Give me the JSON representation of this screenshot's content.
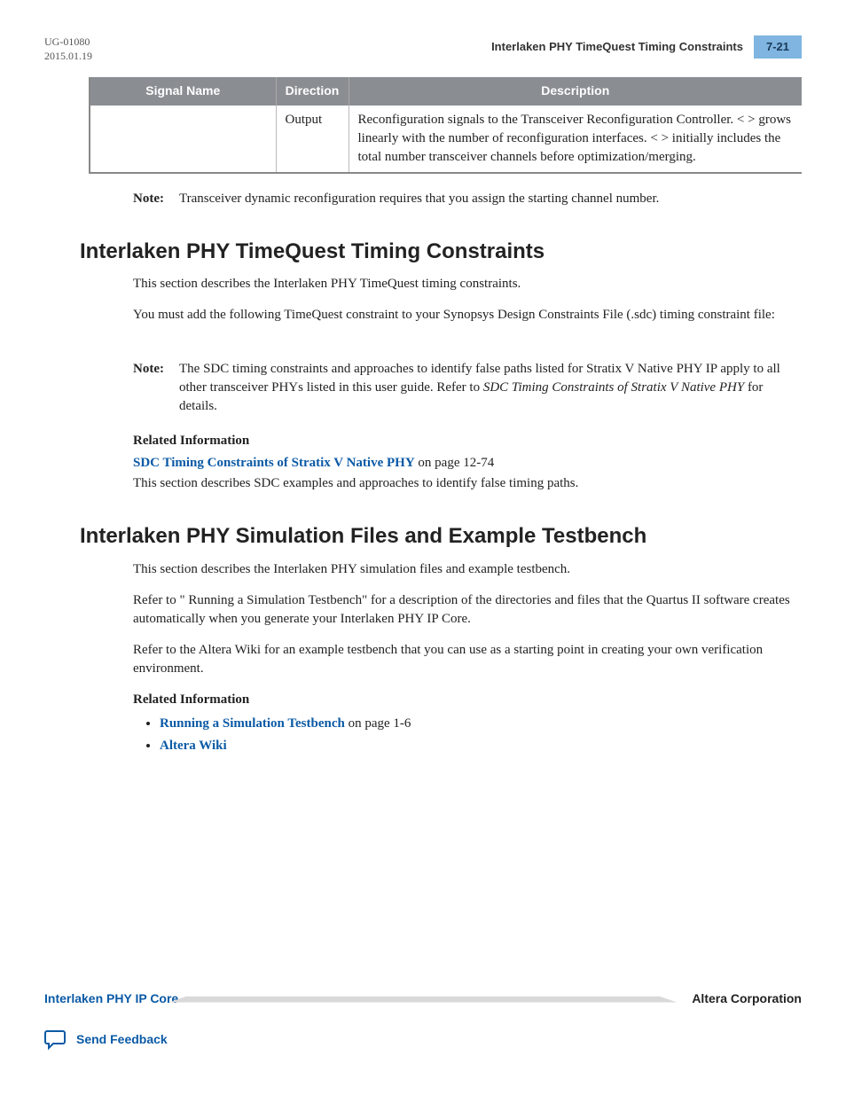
{
  "header": {
    "doc_id": "UG-01080",
    "date": "2015.01.19",
    "running_title": "Interlaken PHY TimeQuest Timing Constraints",
    "page_num": "7-21"
  },
  "table": {
    "headers": [
      "Signal Name",
      "Direction",
      "Description"
    ],
    "row": {
      "signal_name": "",
      "direction": "Output",
      "description": "Reconfiguration signals to the Transceiver Reconfiguration Controller. <  > grows linearly with the number of reconfiguration interfaces. <  > initially includes the total number transceiver channels before optimization/merging."
    }
  },
  "note_top": {
    "label": "Note:",
    "text": "Transceiver dynamic reconfiguration requires that you assign the starting channel number."
  },
  "section1": {
    "heading": "Interlaken PHY TimeQuest Timing Constraints",
    "p1": "This section describes the Interlaken PHY TimeQuest timing constraints.",
    "p2": "You must add the following TimeQuest constraint to your Synopsys Design Constraints File (.sdc) timing constraint file:",
    "note": {
      "label": "Note:",
      "text_pre": "The SDC timing constraints and approaches to identify false paths listed for Stratix V Native PHY IP apply to all other transceiver PHYs listed in this user guide. Refer to ",
      "text_italic": "SDC Timing Constraints of Stratix V Native PHY",
      "text_post": " for details."
    },
    "related_label": "Related Information",
    "related_link": "SDC Timing Constraints of Stratix V Native PHY",
    "related_suffix": " on page 12-74",
    "related_desc": "This section describes SDC examples and approaches to identify false timing paths."
  },
  "section2": {
    "heading": "Interlaken PHY Simulation Files and Example Testbench",
    "p1": "This section describes the Interlaken PHY simulation files and example testbench.",
    "p2": "Refer to \" Running a Simulation Testbench\" for a description of the directories and files that the Quartus II software creates automatically when you generate your Interlaken PHY IP Core.",
    "p3": "Refer to the Altera Wiki for an example testbench that you can use as a starting point in creating your own verification environment.",
    "related_label": "Related Information",
    "links": [
      {
        "text": "Running a Simulation Testbench",
        "suffix": " on page 1-6"
      },
      {
        "text": "Altera Wiki",
        "suffix": ""
      }
    ]
  },
  "footer": {
    "left": "Interlaken PHY IP Core",
    "right": "Altera Corporation",
    "feedback": "Send Feedback"
  }
}
